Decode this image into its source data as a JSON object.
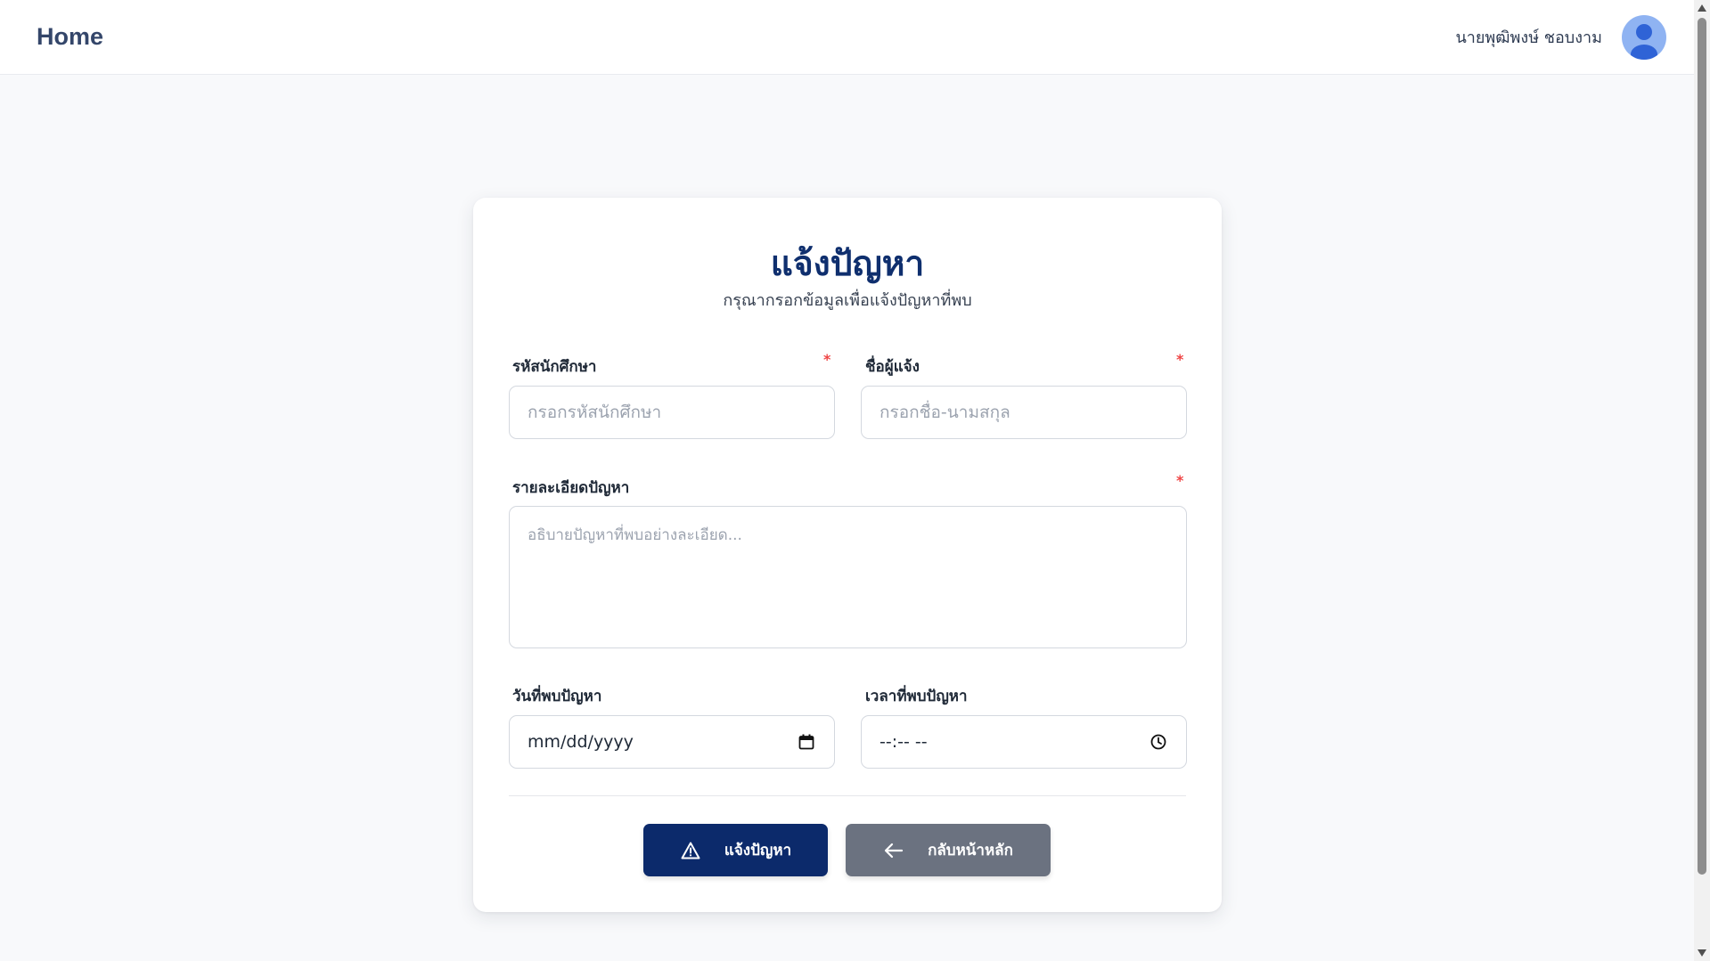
{
  "header": {
    "brand": "Home",
    "user_name": "นายพุฒิพงษ์ ชอบงาม"
  },
  "form": {
    "title": "แจ้งปัญหา",
    "subtitle": "กรุณากรอกข้อมูลเพื่อแจ้งปัญหาที่พบ",
    "student_id": {
      "label": "รหัสนักศึกษา",
      "required_mark": "*",
      "placeholder": "กรอกรหัสนักศึกษา",
      "value": ""
    },
    "reporter_name": {
      "label": "ชื่อผู้แจ้ง",
      "required_mark": "*",
      "placeholder": "กรอกชื่อ-นามสกุล",
      "value": ""
    },
    "details": {
      "label": "รายละเอียดปัญหา",
      "required_mark": "*",
      "placeholder": "อธิบายปัญหาที่พบอย่างละเอียด...",
      "value": ""
    },
    "date_found": {
      "label": "วันที่พบปัญหา",
      "display": "mm/dd/yyyy",
      "icon": "calendar-icon"
    },
    "time_found": {
      "label": "เวลาที่พบปัญหา",
      "display": "--:-- --",
      "icon": "clock-icon"
    },
    "submit_button": {
      "label": "แจ้งปัญหา",
      "icon": "warning-triangle-icon"
    },
    "back_button": {
      "label": "กลับหน้าหลัก",
      "icon": "arrow-left-icon"
    }
  },
  "colors": {
    "primary": "#0c2a6b",
    "secondary": "#6b7280",
    "required": "#ef4444",
    "title": "#0f2f6e",
    "background": "#f8f9fb",
    "avatar": "#8fb3f2"
  }
}
